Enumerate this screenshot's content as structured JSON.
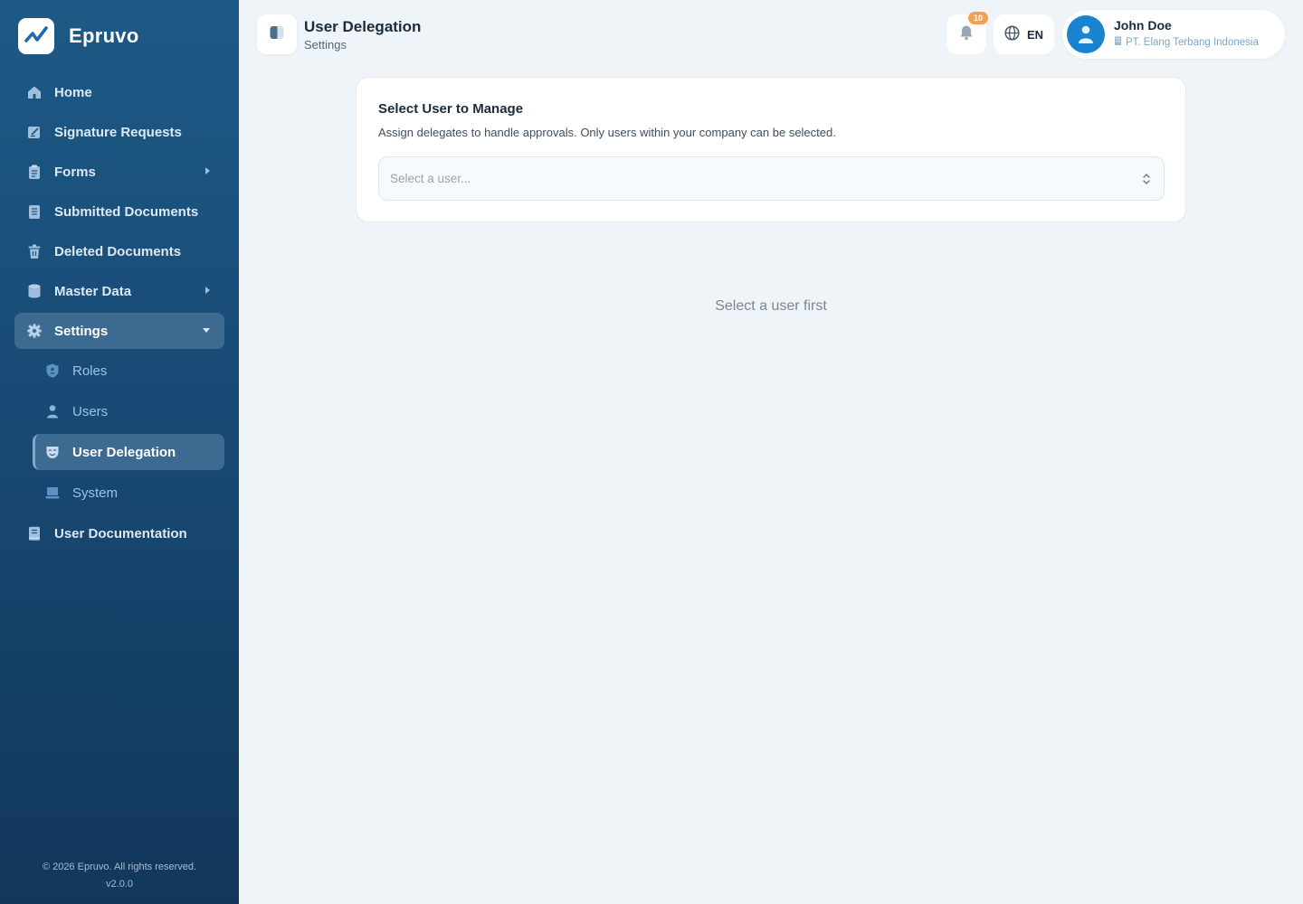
{
  "brand": {
    "name": "Epruvo"
  },
  "sidebar": {
    "items": [
      {
        "label": "Home",
        "icon": "home-icon"
      },
      {
        "label": "Signature Requests",
        "icon": "signature-icon"
      },
      {
        "label": "Forms",
        "icon": "clipboard-icon"
      },
      {
        "label": "Submitted Documents",
        "icon": "document-icon"
      },
      {
        "label": "Deleted Documents",
        "icon": "trash-icon"
      },
      {
        "label": "Master Data",
        "icon": "database-icon"
      },
      {
        "label": "Settings",
        "icon": "gear-icon"
      }
    ],
    "settings_sub": [
      {
        "label": "Roles",
        "icon": "shield-icon"
      },
      {
        "label": "Users",
        "icon": "user-icon"
      },
      {
        "label": "User Delegation",
        "icon": "mask-icon"
      },
      {
        "label": "System",
        "icon": "laptop-icon"
      }
    ],
    "docs": {
      "label": "User Documentation",
      "icon": "book-icon"
    },
    "footer_copyright": "© 2026 Epruvo. All rights reserved.",
    "footer_version": "v2.0.0"
  },
  "header": {
    "title": "User Delegation",
    "breadcrumb": "Settings",
    "notification_count": "10",
    "language": "EN",
    "user_name": "John Doe",
    "user_company": "PT. Elang Terbang Indonesia"
  },
  "main": {
    "card_title": "Select User to Manage",
    "card_description": "Assign delegates to handle approvals. Only users within your company can be selected.",
    "select_placeholder": "Select a user...",
    "empty_message": "Select a user first"
  },
  "colors": {
    "sidebar_top": "#1e5a87",
    "sidebar_bottom": "#12375a",
    "active_item": "#3d6a91",
    "badge": "#f5a051",
    "avatar": "#1a83cf",
    "background": "#eff4f8"
  }
}
